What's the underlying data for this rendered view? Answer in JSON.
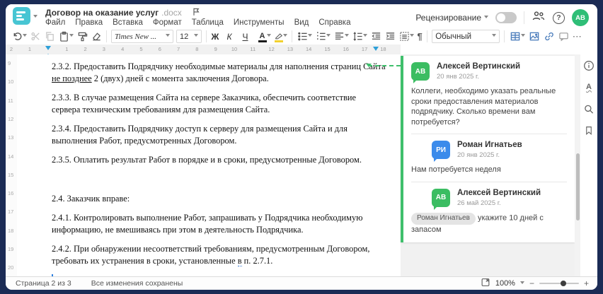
{
  "header": {
    "title": "Договор на оказание услуг",
    "ext": ".docx",
    "review_label": "Рецензирование",
    "avatar_initials": "АВ"
  },
  "menu": {
    "items": [
      "Файл",
      "Правка",
      "Вставка",
      "Формат",
      "Таблица",
      "Инструменты",
      "Вид",
      "Справка"
    ]
  },
  "toolbar": {
    "font_name": "Times New ...",
    "font_size": "12",
    "bold": "Ж",
    "italic": "К",
    "underline": "Ч",
    "font_color_letter": "А",
    "style_name": "Обычный",
    "pilcrow": "¶",
    "more": "⋯"
  },
  "ruler": {
    "h_margin": [
      "2",
      "1"
    ],
    "h_content": [
      "1",
      "2",
      "3",
      "4",
      "5",
      "6",
      "7",
      "8",
      "9",
      "10",
      "11",
      "12",
      "13",
      "14",
      "15",
      "16",
      "17",
      "18"
    ],
    "v": [
      "9",
      "10",
      "11",
      "12",
      "13",
      "14",
      "15",
      "16",
      "17",
      "18",
      "19",
      "20"
    ]
  },
  "doc": {
    "p232_before": "2.3.2. Предоставить Подрядчику необходимые материалы для наполнения страниц Сайта ",
    "p232_marked": "не позднее",
    "p232_after": " 2 (двух) дней с момента заключения Договора.",
    "p233": "2.3.3. В случае размещения Сайта на сервере Заказчика, обеспечить соответствие сервера техническим требованиям для размещения Сайта.",
    "p234": "2.3.4. Предоставить Подрядчику доступ к серверу для размещения Сайта и для выполнения Работ, предусмотренных Договором.",
    "p235": "2.3.5. Оплатить результат Работ в порядке и в сроки, предусмотренные Договором.",
    "p24": "2.4. Заказчик вправе:",
    "p241": "2.4.1. Контролировать выполнение Работ, запрашивать у Подрядчика необходимую информацию, не вмешиваясь при этом в деятельность Подрядчика.",
    "p242_before": "2.4.2. При обнаружении несоответствий требованиям, предусмотренным Договором, требовать их устранения в сроки, установленные ",
    "p242_marked": "в",
    "p242_after": " п. 2.7.1."
  },
  "comments": {
    "thread": [
      {
        "initials": "АВ",
        "name": "Алексей Вертинский",
        "date": "20 янв 2025 г.",
        "text": "Коллеги, необходимо указать реальные сроки предоставления материалов подрядчику. Сколько времени вам потребуется?"
      },
      {
        "initials": "РИ",
        "name": "Роман Игнатьев",
        "date": "20 янв 2025 г.",
        "text": "Нам потребуется неделя"
      },
      {
        "initials": "АВ",
        "name": "Алексей Вертинский",
        "date": "26 май 2025 г.",
        "mention": "Роман Игнатьев",
        "text": "укажите 10 дней с запасом"
      }
    ]
  },
  "rail_icons": [
    "info-icon",
    "spellcheck-icon",
    "search-icon",
    "bookmark-icon"
  ],
  "status": {
    "page_info": "Страница 2 из 3",
    "saved": "Все изменения сохранены",
    "zoom": "100%",
    "minus": "−",
    "plus": "+"
  },
  "colors": {
    "app_background": "#1b2b55",
    "logo_teal": "#47c5d3",
    "comment_green": "#3bbd62",
    "comment_blue": "#3b8beb",
    "avatar_green": "#2fbe77",
    "toolbar_blue": "#4a7cbb",
    "anchor_green": "#3fc06c",
    "indent_marker_blue": "#2d9fd8"
  }
}
